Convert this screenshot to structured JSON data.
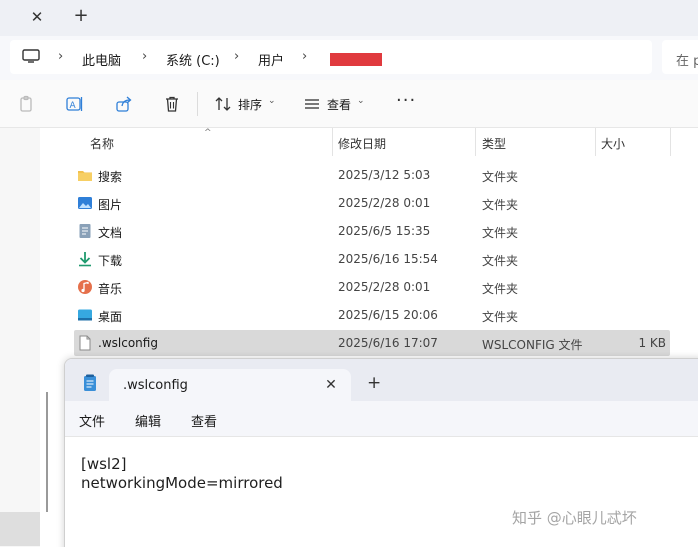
{
  "explorer": {
    "address": {
      "crumbs": [
        "此电脑",
        "系统 (C:)",
        "用户"
      ],
      "separator": "›",
      "search_placeholder": "在 p"
    },
    "toolbar": {
      "sort_label": "排序",
      "view_label": "查看",
      "more_label": "···"
    },
    "columns": [
      "名称",
      "修改日期",
      "类型",
      "大小"
    ],
    "rows": [
      {
        "name": "搜索",
        "date": "2025/3/12 5:03",
        "type": "文件夹",
        "size": "",
        "icon": "search-folder-icon"
      },
      {
        "name": "图片",
        "date": "2025/2/28 0:01",
        "type": "文件夹",
        "size": "",
        "icon": "pictures-folder-icon"
      },
      {
        "name": "文档",
        "date": "2025/6/5 15:35",
        "type": "文件夹",
        "size": "",
        "icon": "documents-folder-icon"
      },
      {
        "name": "下载",
        "date": "2025/6/16 15:54",
        "type": "文件夹",
        "size": "",
        "icon": "downloads-folder-icon"
      },
      {
        "name": "音乐",
        "date": "2025/2/28 0:01",
        "type": "文件夹",
        "size": "",
        "icon": "music-folder-icon"
      },
      {
        "name": "桌面",
        "date": "2025/6/15 20:06",
        "type": "文件夹",
        "size": "",
        "icon": "desktop-folder-icon"
      },
      {
        "name": ".wslconfig",
        "date": "2025/6/16 17:07",
        "type": "WSLCONFIG 文件",
        "size": "1 KB",
        "icon": "file-icon"
      }
    ]
  },
  "notepad": {
    "tab_title": ".wslconfig",
    "menu": [
      "文件",
      "编辑",
      "查看"
    ],
    "content": "[wsl2]\nnetworkingMode=mirrored"
  },
  "watermark": "知乎 @心眼儿忒坏",
  "colors": {
    "redaction": "#e03a3e",
    "selected_row": "#d9d9d9",
    "folder_yellow": "#f2c14e",
    "accent_blue": "#2f7fd8"
  }
}
